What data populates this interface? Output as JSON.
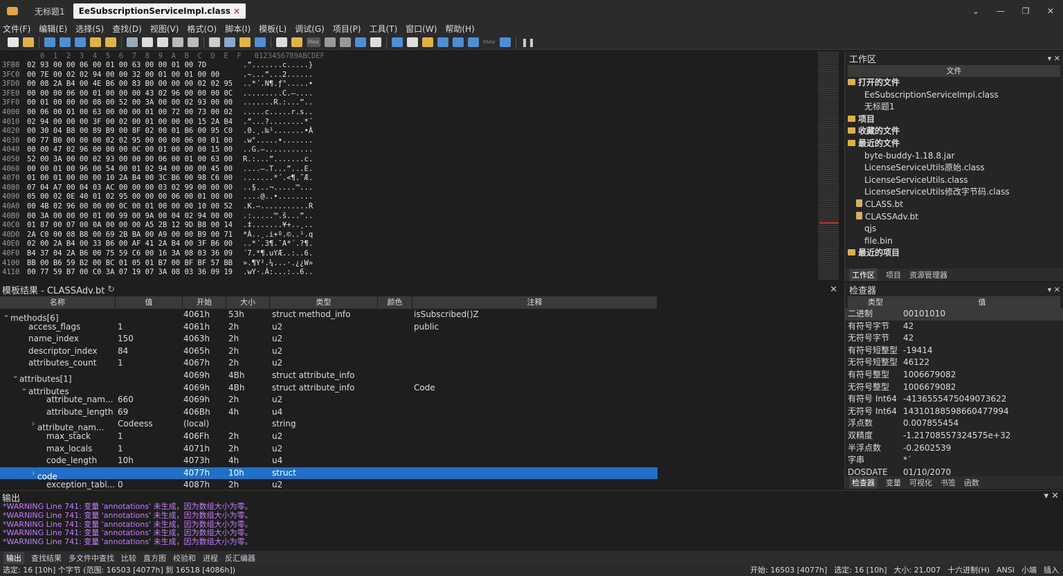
{
  "tabs": [
    {
      "label": "无标题1"
    },
    {
      "label": "EeSubscriptionServiceImpl.class",
      "active": true
    }
  ],
  "menu": [
    "文件(F)",
    "编辑(E)",
    "选择(S)",
    "查找(D)",
    "视图(V)",
    "格式(O)",
    "脚本(I)",
    "模板(L)",
    "调试(G)",
    "项目(P)",
    "工具(T)",
    "窗口(W)",
    "帮助(H)"
  ],
  "hex": {
    "header": "   0  1  2  3  4  5  6  7  8  9  A  B  C  D  E  F   0123456789ABCDEF",
    "rows": [
      {
        "addr": "3FB0",
        "bytes": "02 93 00 00 06 00 01 00 63 00 00 01 00 7D",
        "ascii": ".”.......c.....}"
      },
      {
        "addr": "3FC0",
        "bytes": "00 7E 00 02 02 94 00 00 32 00 01 00 01 00 00",
        "ascii": ".~...”...2......"
      },
      {
        "addr": "3FD0",
        "bytes": "00 08 2A B4 00 4E B6 00 83 B0 00 00 00 02 02 95",
        "ascii": "..*´.N¶.ƒ°.....•"
      },
      {
        "addr": "3FE0",
        "bytes": "00 00 00 06 00 01 00 00 00 43 02 96 00 00 00 0C",
        "ascii": ".........C.–...."
      },
      {
        "addr": "3FF0",
        "bytes": "00 01 00 00 00 08 00 52 00 3A 00 00 02 93 00 00",
        "ascii": ".......R.:...”.."
      },
      {
        "addr": "4000",
        "bytes": "00 06 00 01 00 63 00 00 00 01 00 72 00 73 00 02",
        "ascii": ".....c.....r.s.."
      },
      {
        "addr": "4010",
        "bytes": "02 94 00 00 00 3F 00 02 00 01 00 00 00 15 2A B4",
        "ascii": ".”...?........*´"
      },
      {
        "addr": "4020",
        "bytes": "00 30 04 B8 00 89 B9 00 8F 02 00 01 B6 00 95 C0",
        "ascii": ".0.¸.‰¹.......•À"
      },
      {
        "addr": "4030",
        "bytes": "00 77 B0 00 00 00 02 02 95 00 00 00 06 00 01 00",
        "ascii": ".w°.....•......."
      },
      {
        "addr": "4040",
        "bytes": "00 00 47 02 96 00 00 00 0C 00 01 00 00 00 15 00",
        "ascii": "..G.–..........."
      },
      {
        "addr": "4050",
        "bytes": "52 00 3A 00 00 02 93 00 00 00 06 00 01 00 63 00",
        "ascii": "R.:...”.......c."
      },
      {
        "addr": "4060",
        "bytes": "00 00 01 00 96 00 54 00 01 02 94 00 00 00 45 00",
        "ascii": "....–.T...”...E."
      },
      {
        "addr": "4070",
        "bytes": "01 00 01 00 00 00 10 2A B4 00 3C B6 00 98 C6 00",
        "ascii": ".......*´.<¶.˜Æ.",
        "sel_from": 7
      },
      {
        "addr": "4080",
        "bytes": "07 04 A7 00 04 03 AC 00 00 00 03 02 99 00 00 00",
        "ascii": "..§...¬.....™...",
        "sel_to": 7
      },
      {
        "addr": "4090",
        "bytes": "05 00 02 0E 40 01 02 95 00 00 00 06 00 01 00 00",
        "ascii": "....@..•........"
      },
      {
        "addr": "40A0",
        "bytes": "00 4B 02 96 00 00 00 0C 00 01 00 00 00 10 00 52",
        "ascii": ".K.–...........R"
      },
      {
        "addr": "40B0",
        "bytes": "00 3A 00 00 00 01 00 99 00 9A 00 04 02 94 00 00",
        "ascii": ".:.....™.š...”.."
      },
      {
        "addr": "40C0",
        "bytes": "01 87 00 07 00 0A 00 00 00 A5 2B 12 9D B8 00 14",
        "ascii": ".‡.......¥+..¸.."
      },
      {
        "addr": "40D0",
        "bytes": "2A C0 00 08 B8 00 69 2B BA 00 A9 00 00 B9 00 71",
        "ascii": "*À..¸.i+º.©..¹.q"
      },
      {
        "addr": "40E0",
        "bytes": "02 00 2A B4 00 33 B6 00 AF 41 2A B4 00 3F B6 00",
        "ascii": "..*´.3¶.¯A*´.?¶."
      },
      {
        "addr": "40F0",
        "bytes": "B4 37 04 2A B6 00 75 59 C6 00 16 3A 08 03 36 09",
        "ascii": "´7.*¶.uYÆ..:..6."
      },
      {
        "addr": "4100",
        "bytes": "BB 00 B6 59 B2 00 BC 01 05 01 B7 00 BF BF 57 BB",
        "ascii": "».¶Y².¼...·.¿¿W»"
      },
      {
        "addr": "4110",
        "bytes": "00 77 59 B7 00 C0 3A 07 19 07 3A 08 03 36 09 19",
        "ascii": ".wY·.À:...:..6.."
      }
    ]
  },
  "workspace": {
    "title": "工作区",
    "col": "文件",
    "items": [
      {
        "label": "打开的文件",
        "type": "folder",
        "bold": true
      },
      {
        "label": "EeSubscriptionServiceImpl.class",
        "indent": 2
      },
      {
        "label": "无标题1",
        "indent": 2
      },
      {
        "label": "项目",
        "type": "folder",
        "bold": true
      },
      {
        "label": "收藏的文件",
        "type": "folder",
        "bold": true
      },
      {
        "label": "最近的文件",
        "type": "folder",
        "bold": true
      },
      {
        "label": "byte-buddy-1.18.8.jar",
        "indent": 2
      },
      {
        "label": "LicenseServiceUtils原始.class",
        "indent": 2
      },
      {
        "label": "LicenseServiceUtils.class",
        "indent": 2
      },
      {
        "label": "LicenseServiceUtils修改字节码.class",
        "indent": 2
      },
      {
        "label": "CLASS.bt",
        "indent": 1,
        "type": "file"
      },
      {
        "label": "CLASSAdv.bt",
        "indent": 1,
        "type": "file"
      },
      {
        "label": "qjs",
        "indent": 2
      },
      {
        "label": "file.bin",
        "indent": 2
      },
      {
        "label": "最近的项目",
        "type": "folder",
        "bold": true
      }
    ],
    "tabs": [
      "工作区",
      "项目",
      "资源管理器"
    ]
  },
  "template": {
    "title": "模板结果 - CLASSAdv.bt",
    "cols": [
      "名称",
      "值",
      "开始",
      "大小",
      "类型",
      "颜色",
      "注释"
    ],
    "rows": [
      {
        "name": "methods[6]",
        "indent": 1,
        "exp": "v",
        "val": "",
        "start": "4061h",
        "size": "53h",
        "type": "struct method_info",
        "note": "isSubscribed()Z"
      },
      {
        "name": "access_flags",
        "indent": 3,
        "val": "1",
        "start": "4061h",
        "size": "2h",
        "type": "u2",
        "note": "public"
      },
      {
        "name": "name_index",
        "indent": 3,
        "val": "150",
        "start": "4063h",
        "size": "2h",
        "type": "u2",
        "note": ""
      },
      {
        "name": "descriptor_index",
        "indent": 3,
        "val": "84",
        "start": "4065h",
        "size": "2h",
        "type": "u2",
        "note": ""
      },
      {
        "name": "attributes_count",
        "indent": 3,
        "val": "1",
        "start": "4067h",
        "size": "2h",
        "type": "u2",
        "note": ""
      },
      {
        "name": "attributes[1]",
        "indent": 2,
        "exp": "v",
        "val": "",
        "start": "4069h",
        "size": "4Bh",
        "type": "struct attribute_info",
        "note": ""
      },
      {
        "name": "attributes",
        "indent": 3,
        "exp": "v",
        "val": "",
        "start": "4069h",
        "size": "4Bh",
        "type": "struct attribute_info",
        "note": "Code"
      },
      {
        "name": "attribute_nam...",
        "indent": 5,
        "val": "660",
        "start": "4069h",
        "size": "2h",
        "type": "u2",
        "note": ""
      },
      {
        "name": "attribute_length",
        "indent": 5,
        "val": "69",
        "start": "406Bh",
        "size": "4h",
        "type": "u4",
        "note": ""
      },
      {
        "name": "attribute_nam...",
        "indent": 4,
        "exp": ">",
        "val": "Codeess",
        "start": "(local)",
        "size": "",
        "type": "string",
        "note": ""
      },
      {
        "name": "max_stack",
        "indent": 5,
        "val": "1",
        "start": "406Fh",
        "size": "2h",
        "type": "u2",
        "note": ""
      },
      {
        "name": "max_locals",
        "indent": 5,
        "val": "1",
        "start": "4071h",
        "size": "2h",
        "type": "u2",
        "note": ""
      },
      {
        "name": "code_length",
        "indent": 5,
        "val": "10h",
        "start": "4073h",
        "size": "4h",
        "type": "u4",
        "note": ""
      },
      {
        "name": "code",
        "indent": 4,
        "exp": ">",
        "val": "",
        "start": "4077h",
        "size": "10h",
        "type": "struct",
        "note": "",
        "hl": true
      },
      {
        "name": "exception_tabl...",
        "indent": 5,
        "val": "0",
        "start": "4087h",
        "size": "2h",
        "type": "u2",
        "note": ""
      }
    ]
  },
  "inspector": {
    "title": "检查器",
    "cols": [
      "类型",
      "值"
    ],
    "rows": [
      {
        "k": "二进制",
        "v": "00101010"
      },
      {
        "k": "有符号字节",
        "v": "42"
      },
      {
        "k": "无符号字节",
        "v": "42"
      },
      {
        "k": "有符号短整型",
        "v": "-19414"
      },
      {
        "k": "无符号短整型",
        "v": "46122"
      },
      {
        "k": "有符号整型",
        "v": "1006679082"
      },
      {
        "k": "无符号整型",
        "v": "1006679082"
      },
      {
        "k": "有符号 Int64",
        "v": "-4136555475049073622"
      },
      {
        "k": "无符号 Int64",
        "v": "14310188598660477994"
      },
      {
        "k": "浮点数",
        "v": "0.007855454"
      },
      {
        "k": "双精度",
        "v": "-1.21708557324575e+32"
      },
      {
        "k": "半浮点数",
        "v": "-0.2602539"
      },
      {
        "k": "字串",
        "v": "*´"
      },
      {
        "k": "DOSDATE",
        "v": "01/10/2070"
      }
    ],
    "tabs": [
      "检查器",
      "变量",
      "可视化",
      "书签",
      "函数"
    ]
  },
  "output": {
    "title": "输出",
    "lines": [
      "*WARNING Line 741: 变量 'annotations' 未生成，因为数组大小为零。",
      "*WARNING Line 741: 变量 'annotations' 未生成，因为数组大小为零。",
      "*WARNING Line 741: 变量 'annotations' 未生成，因为数组大小为零。",
      "*WARNING Line 741: 变量 'annotations' 未生成，因为数组大小为零。",
      "*WARNING Line 741: 变量 'annotations' 未生成，因为数组大小为零。"
    ]
  },
  "bottomtabs": [
    "输出",
    "查找结果",
    "多文件中查找",
    "比较",
    "直方图",
    "校验和",
    "进程",
    "反汇编器"
  ],
  "status": {
    "left": "选定: 16 [10h] 个字节 (范围: 16503 [4077h] 到 16518 [4086h])",
    "right": [
      "开始: 16503 [4077h]",
      "选定: 16 [10h]",
      "大小: 21,007",
      "十六进制(H)",
      "ANSI",
      "小端",
      "插入"
    ]
  },
  "colors": {
    "accent": "#1e70c8",
    "selection": "#8b1a1a",
    "warning": "#c77dff"
  }
}
